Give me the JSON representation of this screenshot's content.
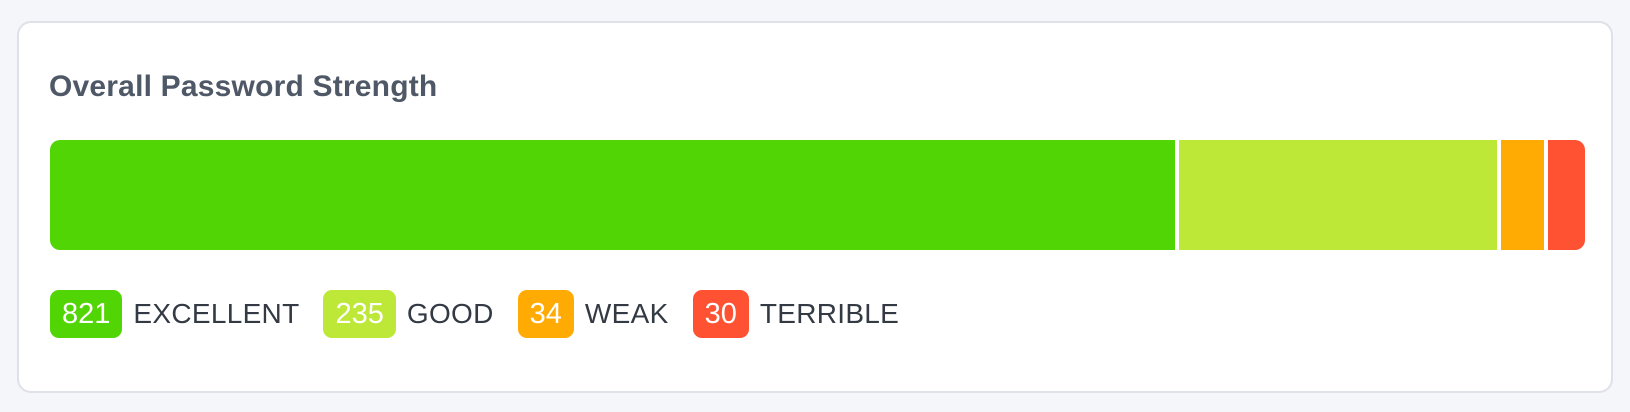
{
  "card": {
    "title": "Overall Password Strength"
  },
  "strength": [
    {
      "key": "excellent",
      "count": 821,
      "count_label": "821",
      "label": "EXCELLENT",
      "color": "#52d504"
    },
    {
      "key": "good",
      "count": 235,
      "count_label": "235",
      "label": "GOOD",
      "color": "#bde838"
    },
    {
      "key": "weak",
      "count": 34,
      "count_label": "34",
      "label": "WEAK",
      "color": "#ffab04"
    },
    {
      "key": "terrible",
      "count": 30,
      "count_label": "30",
      "label": "TERRIBLE",
      "color": "#ff5232"
    }
  ]
}
